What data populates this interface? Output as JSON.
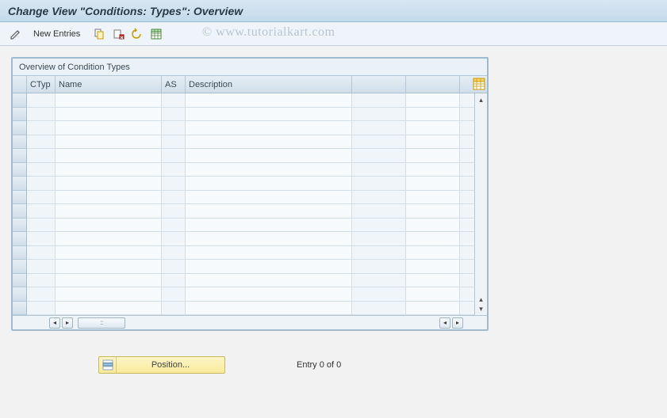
{
  "title": "Change View \"Conditions: Types\": Overview",
  "toolbar": {
    "new_entries_label": "New Entries"
  },
  "watermark": "© www.tutorialkart.com",
  "grid": {
    "title": "Overview of Condition Types",
    "columns": {
      "ctyp": "CTyp",
      "name": "Name",
      "as": "AS",
      "description": "Description"
    },
    "rows": []
  },
  "footer": {
    "position_label": "Position...",
    "entry_text": "Entry 0 of 0"
  },
  "chart_data": {
    "type": "table",
    "title": "Overview of Condition Types",
    "columns": [
      "CTyp",
      "Name",
      "AS",
      "Description"
    ],
    "rows": [],
    "entry_summary": "Entry 0 of 0"
  }
}
